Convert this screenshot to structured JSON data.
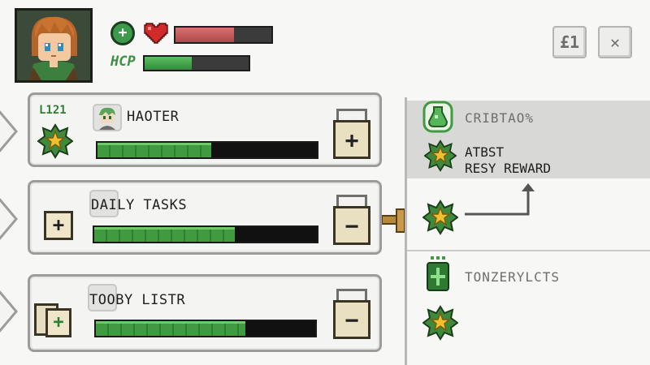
{
  "colors": {
    "health": "#c25b5b",
    "xp": "#3f9a40",
    "panel_border": "#9c9c9a",
    "reward_bg": "#d8d8d6"
  },
  "header": {
    "portrait_icon": "hero-portrait",
    "health": {
      "icon": "heart-icon",
      "add_icon": "plus-circle-icon",
      "fill": 0.61
    },
    "xp": {
      "label": "HCP",
      "fill": 0.45
    },
    "currency_button": "£1",
    "close_button": "✕"
  },
  "quests": [
    {
      "level": "L121",
      "left_icon": "star-badge-icon",
      "title": "HAOTER",
      "title_icon": "avatar-icon",
      "progress": 0.52,
      "action": "+",
      "action_icon": "crate-plus-icon"
    },
    {
      "level": "",
      "left_icon": "plus-tile-icon",
      "title": "DAILY TASKS",
      "title_icon": "label-box-icon",
      "progress": 0.63,
      "action": "−",
      "action_icon": "crate-minus-icon"
    },
    {
      "level": "",
      "left_icon": "stacked-plus-tiles-icon",
      "title": "TOOBY LISTR",
      "title_icon": "label-box-icon",
      "progress": 0.68,
      "action": "−",
      "action_icon": "crate-minus-icon"
    }
  ],
  "rewards": {
    "section1_title": "CRIBTAO%",
    "section1_icon": "potion-icon",
    "reward_text_line1": "ATBST",
    "reward_text_line2": "RESY REWARD",
    "reward_icon": "star-badge-icon",
    "next_icon": "star-badge-icon",
    "section2_title": "TONZERYLCTS",
    "section2_icon": "green-gem-icon",
    "section2_star_icon": "star-badge-icon"
  }
}
